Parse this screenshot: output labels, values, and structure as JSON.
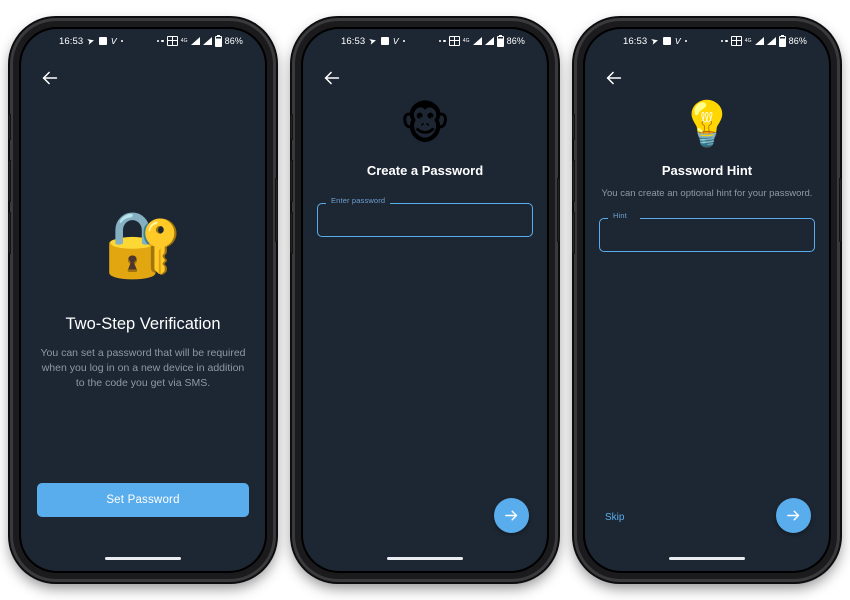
{
  "status_bar": {
    "time": "16:53",
    "battery_percent": "86%",
    "network_label": "4G",
    "icons": [
      "send-icon",
      "white-square-icon",
      "v-icon",
      "dot-icon",
      "two-dots-icon",
      "grid-icon",
      "network-4g-icon",
      "signal-bars-icon",
      "signal-bars-2-icon",
      "battery-icon"
    ]
  },
  "colors": {
    "accent": "#5aaded",
    "screen_bg": "#1d2733",
    "title_text": "#ffffff",
    "subtitle_text": "#8d99a6",
    "field_label": "#6f9fd0"
  },
  "screens": [
    {
      "id": "two-step-verification",
      "back_label": "Back",
      "emoji": "🔐",
      "emoji_name": "locked-with-key-emoji",
      "title": "Two-Step Verification",
      "subtitle": "You can set a password that will be required when you log in on a new device in addition to the code you get via SMS.",
      "primary_button": "Set Password"
    },
    {
      "id": "create-a-password",
      "back_label": "Back",
      "emoji": "🐵",
      "emoji_name": "monkey-face-emoji",
      "title": "Create a Password",
      "field_label": "Enter password",
      "field_value": "",
      "fab_label": "Next"
    },
    {
      "id": "password-hint",
      "back_label": "Back",
      "emoji": "💡",
      "emoji_name": "light-bulb-emoji",
      "title": "Password Hint",
      "subtitle": "You can create an optional hint for your password.",
      "field_label": "Hint",
      "field_value": "",
      "skip_label": "Skip",
      "fab_label": "Next"
    }
  ]
}
